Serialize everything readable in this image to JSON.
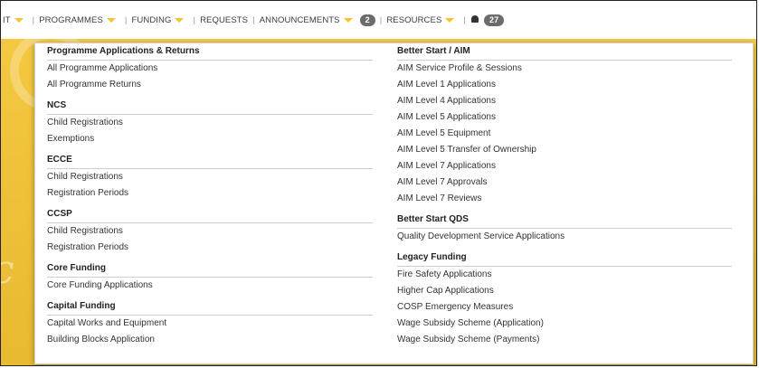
{
  "nav": {
    "partial_item": "IT",
    "items": [
      {
        "label": "PROGRAMMES",
        "caret": true
      },
      {
        "label": "FUNDING",
        "caret": true
      },
      {
        "label": "REQUESTS",
        "caret": false
      },
      {
        "label": "ANNOUNCEMENTS",
        "caret": true,
        "badge": "2"
      },
      {
        "label": "RESOURCES",
        "caret": true
      }
    ],
    "notifications_badge": "27"
  },
  "menu": {
    "left": [
      {
        "title": "Programme Applications & Returns",
        "links": [
          "All Programme Applications",
          "All Programme Returns"
        ]
      },
      {
        "title": "NCS",
        "links": [
          "Child Registrations",
          "Exemptions"
        ]
      },
      {
        "title": "ECCE",
        "links": [
          "Child Registrations",
          "Registration Periods"
        ]
      },
      {
        "title": "CCSP",
        "links": [
          "Child Registrations",
          "Registration Periods"
        ]
      },
      {
        "title": "Core Funding",
        "links": [
          "Core Funding Applications"
        ]
      },
      {
        "title": "Capital Funding",
        "links": [
          "Capital Works and Equipment",
          "Building Blocks Application"
        ]
      }
    ],
    "right": [
      {
        "title": "Better Start / AIM",
        "links": [
          "AIM Service Profile & Sessions",
          "AIM Level 1 Applications",
          "AIM Level 4 Applications",
          "AIM Level 5 Applications",
          "AIM Level 5 Equipment",
          "AIM Level 5 Transfer of Ownership",
          "AIM Level 7 Applications",
          "AIM Level 7 Approvals",
          "AIM Level 7 Reviews"
        ]
      },
      {
        "title": "Better Start QDS",
        "links": [
          "Quality Development Service Applications"
        ]
      },
      {
        "title": "Legacy Funding",
        "links": [
          "Fire Safety Applications",
          "Higher Cap Applications",
          "COSP Emergency Measures",
          "Wage Subsidy Scheme (Application)",
          "Wage Subsidy Scheme (Payments)"
        ]
      }
    ]
  },
  "colors": {
    "accent": "#f4c430",
    "banner": "#f5c842",
    "badge": "#6b6b6b"
  }
}
